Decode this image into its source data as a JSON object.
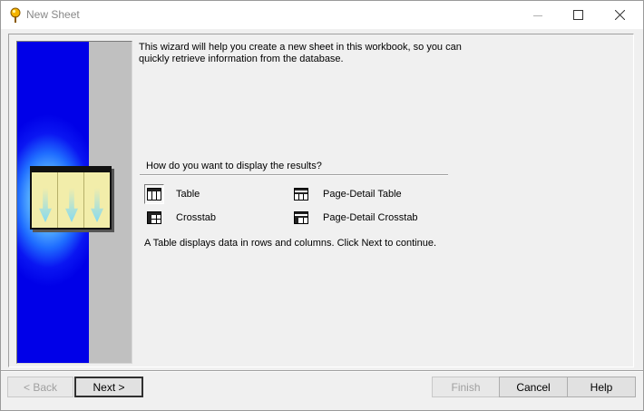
{
  "window": {
    "title": "New Sheet"
  },
  "intro": "This wizard will help you create a new sheet in this workbook, so you can quickly retrieve information from the database.",
  "question": "How do you want to display the results?",
  "options": [
    {
      "label": "Table",
      "icon": "table-icon",
      "selected": true
    },
    {
      "label": "Crosstab",
      "icon": "crosstab-icon",
      "selected": false
    },
    {
      "label": "Page-Detail Table",
      "icon": "page-detail-table-icon",
      "selected": false
    },
    {
      "label": "Page-Detail Crosstab",
      "icon": "page-detail-crosstab-icon",
      "selected": false
    }
  ],
  "description": "A Table displays data in rows and columns. Click Next to continue.",
  "buttons": {
    "back": "< Back",
    "next": "Next >",
    "finish": "Finish",
    "cancel": "Cancel",
    "help": "Help"
  },
  "colors": {
    "wizard_art_blue": "#0000e8",
    "wizard_art_gray": "#c0c0c0",
    "sheet_yellow": "#f2edaa"
  }
}
